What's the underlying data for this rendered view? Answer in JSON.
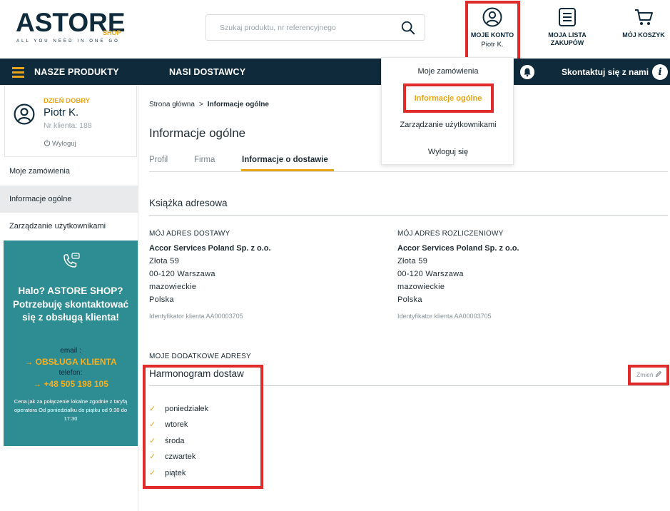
{
  "header": {
    "logo_main": "ASTORE",
    "logo_shop": "SHOP",
    "logo_tagline": "ALL YOU NEED IN ONE GO",
    "search_placeholder": "Szukaj produktu, nr referencyjnego",
    "account_label": "MOJE KONTO",
    "account_user": "Piotr K.",
    "shopping_list_label": "MOJA LISTA ZAKUPÓW",
    "cart_label": "MÓJ KOSZYK"
  },
  "navbar": {
    "products": "NASZE PRODUKTY",
    "suppliers": "NASI DOSTAWCY",
    "contact": "Skontaktuj się z nami"
  },
  "dropdown": {
    "items": [
      "Moje zamówienia",
      "Informacje ogólne",
      "Zarządzanie użytkownikami",
      "Wyloguj się"
    ],
    "active_index": 1
  },
  "sidebar": {
    "greeting": "DZIEŃ DOBRY",
    "user_name": "Piotr K.",
    "client_number": "Nr klienta: 188",
    "logout": "Wyloguj",
    "items": [
      "Moje zamówienia",
      "Informacje ogólne",
      "Zarządzanie użytkownikami"
    ],
    "active_index": 1
  },
  "help": {
    "title": "Halo? ASTORE SHOP? Potrzebuję skontaktować się z obsługą klienta!",
    "email_label": "email :",
    "email_link": "→ OBSŁUGA KLIENTA",
    "phone_label": "telefon:",
    "phone_link": "→ +48 505 198 105",
    "note": "Cena jak za połączenie lokalne zgodnie z taryfą operatora Od poniedziałku do piątku od 9:30 do 17:30"
  },
  "main": {
    "breadcrumb_home": "Strona główna",
    "breadcrumb_sep": ">",
    "breadcrumb_current": "Informacje ogólne",
    "page_title": "Informacje ogólne",
    "tabs": [
      "Profil",
      "Firma",
      "Informacje o dostawie"
    ],
    "active_tab": 2,
    "address_book_title": "Książka adresowa",
    "delivery_address": {
      "heading": "MÓJ ADRES DOSTAWY",
      "company": "Accor Services Poland Sp. z o.o.",
      "street": "Złota 59",
      "city": "00-120 Warszawa",
      "region": "mazowieckie",
      "country": "Polska",
      "identifier": "Identyfikator klienta AA00003705"
    },
    "billing_address": {
      "heading": "MÓJ ADRES ROZLICZENIOWY",
      "company": "Accor Services Poland Sp. z o.o.",
      "street": "Złota 59",
      "city": "00-120 Warszawa",
      "region": "mazowieckie",
      "country": "Polska",
      "identifier": "Identyfikator klienta AA00003705"
    },
    "extra_addresses_heading": "MOJE DODATKOWE ADRESY",
    "schedule_title": "Harmonogram dostaw",
    "change_label": "Zmień",
    "days": [
      "poniedziałek",
      "wtorek",
      "środa",
      "czwartek",
      "piątek"
    ]
  },
  "colors": {
    "navy": "#0e2a3b",
    "accent": "#e9a516",
    "teal": "#2e8c93",
    "highlight_red": "#e02b2b"
  }
}
